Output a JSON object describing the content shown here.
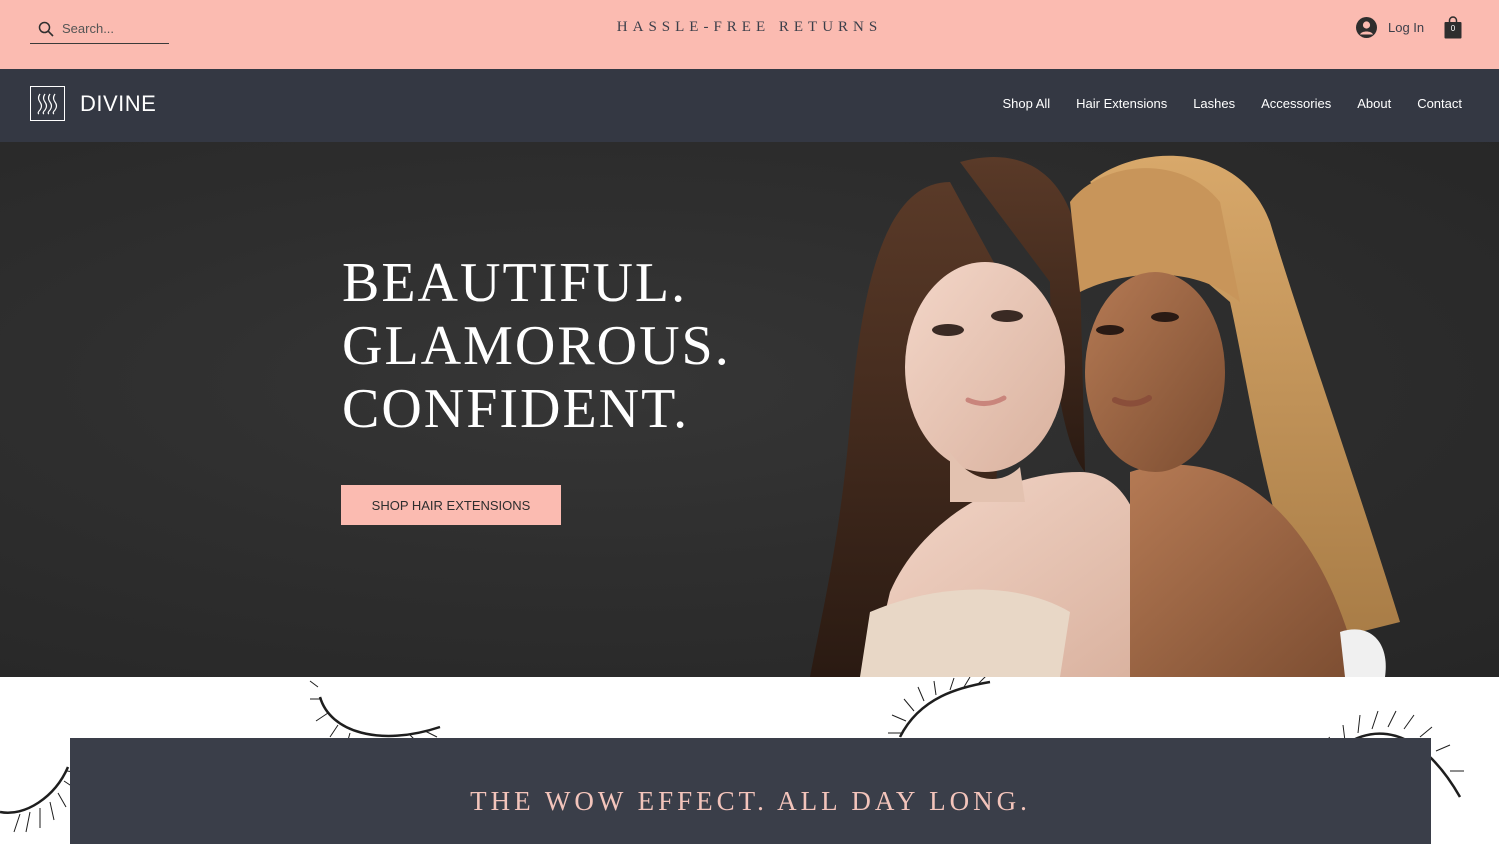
{
  "topbar": {
    "search_placeholder": "Search...",
    "announcement": "HASSLE-FREE RETURNS",
    "login_label": "Log In",
    "cart_count": "0"
  },
  "header": {
    "brand": "DIVINE",
    "nav": [
      "Shop All",
      "Hair Extensions",
      "Lashes",
      "Accessories",
      "About",
      "Contact"
    ]
  },
  "hero": {
    "headline": [
      "BEAUTIFUL.",
      "GLAMOROUS.",
      "CONFIDENT."
    ],
    "cta_label": "SHOP HAIR EXTENSIONS"
  },
  "promo": {
    "tagline": "THE WOW EFFECT. ALL DAY LONG."
  },
  "colors": {
    "accent_pink": "#fbbbb1",
    "header_dark": "#343843",
    "hero_dark": "#2e2e2e",
    "panel_dark": "#3a3e49"
  },
  "icons": [
    "search-icon",
    "user-icon",
    "shopping-bag-icon",
    "wave-logo-icon"
  ]
}
